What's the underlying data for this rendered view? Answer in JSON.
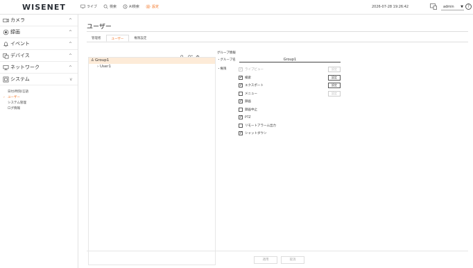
{
  "app": {
    "logo": "WISENET",
    "datetime": "2026-07-28 19:26:42",
    "user": "admin",
    "help": "?"
  },
  "topnav": [
    {
      "label": "ライブ",
      "icon": "monitor-icon",
      "active": false
    },
    {
      "label": "検索",
      "icon": "search-icon",
      "active": false
    },
    {
      "label": "AI検索",
      "icon": "ai-search-icon",
      "active": false
    },
    {
      "label": "設定",
      "icon": "gear-icon",
      "active": true
    }
  ],
  "sidebar": {
    "groups": [
      {
        "label": "カメラ",
        "icon": "camera-icon",
        "chevron": "^"
      },
      {
        "label": "録画",
        "icon": "record-icon",
        "chevron": "^"
      },
      {
        "label": "イベント",
        "icon": "bell-icon",
        "chevron": "^"
      },
      {
        "label": "デバイス",
        "icon": "device-icon",
        "chevron": "^"
      },
      {
        "label": "ネットワーク",
        "icon": "network-icon",
        "chevron": "^"
      },
      {
        "label": "システム",
        "icon": "system-icon",
        "chevron": "v"
      }
    ],
    "system_items": [
      {
        "label": "日付/時刻/言語",
        "active": false
      },
      {
        "label": "ユーザー",
        "active": true
      },
      {
        "label": "システム管理",
        "active": false
      },
      {
        "label": "ログ情報",
        "active": false
      }
    ]
  },
  "main": {
    "title": "ユーザー",
    "tabs": [
      {
        "label": "管理者",
        "active": false
      },
      {
        "label": "ユーザー",
        "active": true
      },
      {
        "label": "権限設定",
        "active": false
      }
    ],
    "tree": {
      "group": "Group1",
      "user": "User1"
    },
    "detail": {
      "heading": "グループ情報",
      "group_name_label": "・グループ名",
      "group_name_value": "Group1",
      "permission_label": "・権限",
      "permissions": [
        {
          "label": "ライブビュー",
          "checked": true,
          "disabled": true,
          "button": "設定",
          "button_disabled": true
        },
        {
          "label": "検索",
          "checked": true,
          "disabled": false,
          "button": "設定",
          "button_disabled": false
        },
        {
          "label": "エクスポート",
          "checked": true,
          "disabled": false,
          "button": "設定",
          "button_disabled": false
        },
        {
          "label": "メニュー",
          "checked": false,
          "disabled": false,
          "button": "設定",
          "button_disabled": true
        },
        {
          "label": "録画",
          "checked": true,
          "disabled": false,
          "button": "",
          "button_disabled": false
        },
        {
          "label": "録画中止",
          "checked": false,
          "disabled": false,
          "button": "",
          "button_disabled": false
        },
        {
          "label": "PTZ",
          "checked": true,
          "disabled": false,
          "button": "",
          "button_disabled": false
        },
        {
          "label": "リモートアラーム出力",
          "checked": false,
          "disabled": false,
          "button": "",
          "button_disabled": false
        },
        {
          "label": "シャットダウン",
          "checked": true,
          "disabled": false,
          "button": "",
          "button_disabled": false
        }
      ]
    },
    "footer": {
      "apply": "適用",
      "cancel": "取消"
    }
  },
  "colors": {
    "accent": "#f37321",
    "selected_row": "#fdebd8",
    "border": "#e2e2e2"
  }
}
